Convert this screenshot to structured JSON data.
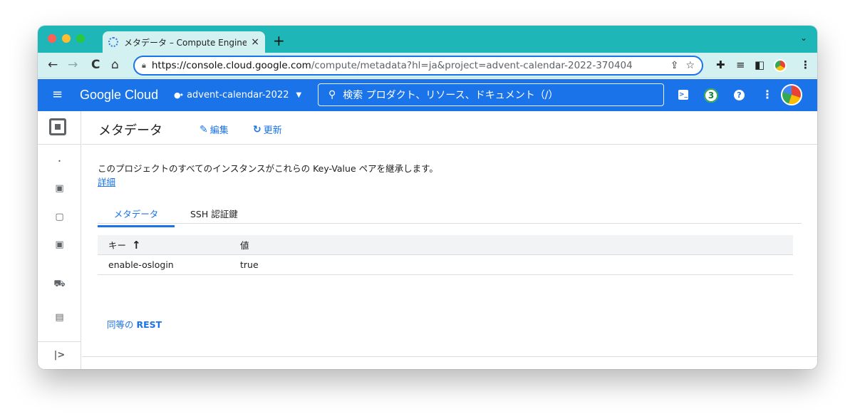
{
  "browser": {
    "tab_title": "メタデータ – Compute Engine –",
    "tab_close": "×",
    "new_tab": "+",
    "tab_menu": "⌄",
    "url_scheme_host": "https://console.cloud.google.com",
    "url_path": "/compute/metadata?hl=ja&project=advent-calendar-2022-370404"
  },
  "header": {
    "logo": "Google Cloud",
    "project": "advent-calendar-2022",
    "search_placeholder": "検索 プロダクト、リソース、ドキュメント（/）",
    "notification_count": "3"
  },
  "page": {
    "title": "メタデータ",
    "edit_label": "編集",
    "refresh_label": "更新",
    "description": "このプロジェクトのすべてのインスタンスがこれらの Key-Value ペアを継承します。",
    "learn_more": "詳細"
  },
  "tabs": [
    {
      "label": "メタデータ"
    },
    {
      "label": "SSH 認証鍵"
    }
  ],
  "table": {
    "headers": {
      "key": "キー",
      "value": "値"
    },
    "rows": [
      {
        "key": "enable-oslogin",
        "value": "true"
      }
    ]
  },
  "footer": {
    "equivalent_prefix": "同等の",
    "equivalent_rest": "REST"
  },
  "colors": {
    "tab_strip": "#1fb6b8",
    "header_blue": "#1a73e8",
    "link_blue": "#1a73e8"
  }
}
